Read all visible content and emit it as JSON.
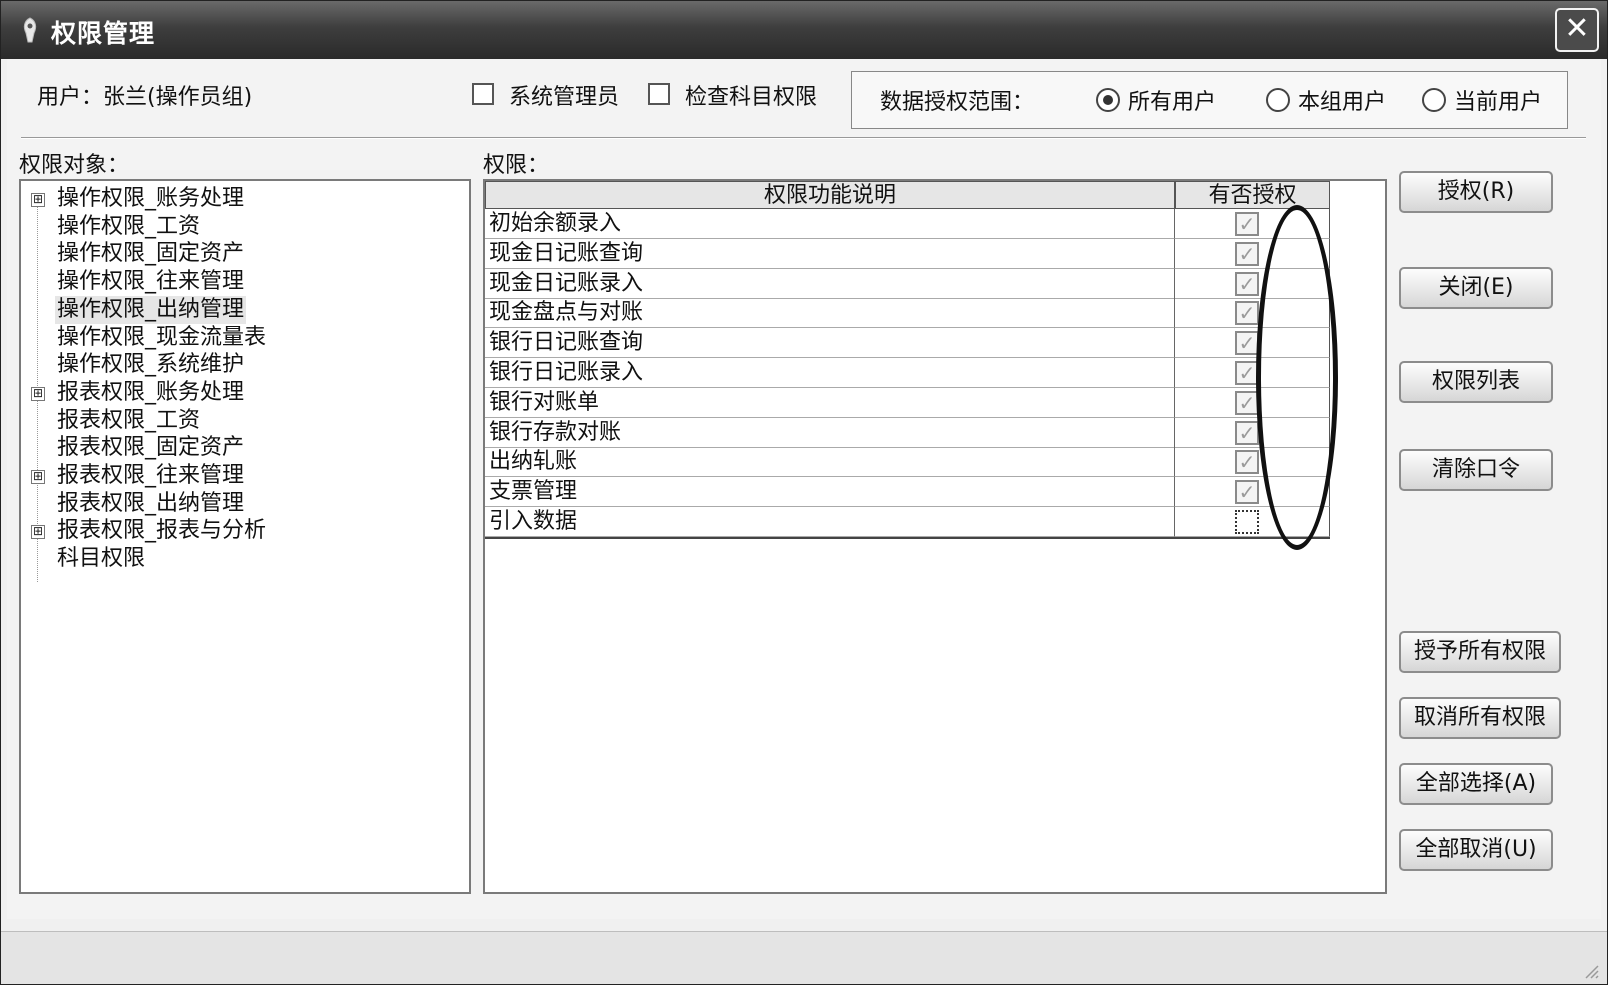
{
  "window": {
    "title": "权限管理",
    "close_symbol": "✕"
  },
  "header": {
    "user_label": "用户：张兰(操作员组)",
    "checkbox_sysadmin": "系统管理员",
    "checkbox_subject_perm": "检查科目权限",
    "data_scope_label": "数据授权范围：",
    "radios": [
      {
        "label": "所有用户",
        "selected": true
      },
      {
        "label": "本组用户",
        "selected": false
      },
      {
        "label": "当前用户",
        "selected": false
      }
    ]
  },
  "tree": {
    "title": "权限对象：",
    "items": [
      {
        "label": "操作权限_账务处理",
        "expandable": true,
        "selected": false
      },
      {
        "label": "操作权限_工资",
        "expandable": false,
        "selected": false
      },
      {
        "label": "操作权限_固定资产",
        "expandable": false,
        "selected": false
      },
      {
        "label": "操作权限_往来管理",
        "expandable": false,
        "selected": false
      },
      {
        "label": "操作权限_出纳管理",
        "expandable": false,
        "selected": true
      },
      {
        "label": "操作权限_现金流量表",
        "expandable": false,
        "selected": false
      },
      {
        "label": "操作权限_系统维护",
        "expandable": false,
        "selected": false
      },
      {
        "label": "报表权限_账务处理",
        "expandable": true,
        "selected": false
      },
      {
        "label": "报表权限_工资",
        "expandable": false,
        "selected": false
      },
      {
        "label": "报表权限_固定资产",
        "expandable": false,
        "selected": false
      },
      {
        "label": "报表权限_往来管理",
        "expandable": true,
        "selected": false
      },
      {
        "label": "报表权限_出纳管理",
        "expandable": false,
        "selected": false
      },
      {
        "label": "报表权限_报表与分析",
        "expandable": true,
        "selected": false
      },
      {
        "label": "科目权限",
        "expandable": false,
        "selected": false
      }
    ],
    "expand_symbol": "⊞"
  },
  "grid": {
    "title": "权限：",
    "col_desc": "权限功能说明",
    "col_auth": "有否授权",
    "check_symbol": "✓",
    "rows": [
      {
        "desc": "初始余额录入",
        "granted": true
      },
      {
        "desc": "现金日记账查询",
        "granted": true
      },
      {
        "desc": "现金日记账录入",
        "granted": true
      },
      {
        "desc": "现金盘点与对账",
        "granted": true
      },
      {
        "desc": "银行日记账查询",
        "granted": true
      },
      {
        "desc": "银行日记账录入",
        "granted": true
      },
      {
        "desc": "银行对账单",
        "granted": true
      },
      {
        "desc": "银行存款对账",
        "granted": true
      },
      {
        "desc": "出纳轧账",
        "granted": true
      },
      {
        "desc": "支票管理",
        "granted": true
      },
      {
        "desc": "引入数据",
        "granted": false
      }
    ]
  },
  "buttons": {
    "authorize": "授权(R)",
    "close": "关闭(E)",
    "perm_list": "权限列表",
    "clear_password": "清除口令",
    "grant_all": "授予所有权限",
    "revoke_all": "取消所有权限",
    "select_all": "全部选择(A)",
    "deselect_all": "全部取消(U)"
  }
}
